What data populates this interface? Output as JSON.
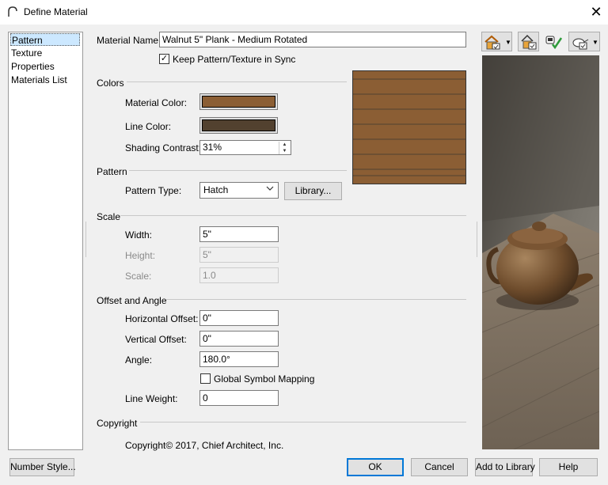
{
  "window": {
    "title": "Define Material",
    "close_glyph": "✕"
  },
  "nav": {
    "items": [
      "Pattern",
      "Texture",
      "Properties",
      "Materials List"
    ],
    "selected": "Pattern"
  },
  "material": {
    "name_label": "Material Name:",
    "name_value": "Walnut 5\" Plank - Medium Rotated",
    "keep_sync_label": "Keep Pattern/Texture in Sync",
    "keep_sync_checked": true
  },
  "colors": {
    "heading": "Colors",
    "material_color_label": "Material Color:",
    "material_color": "#8b5e34",
    "line_color_label": "Line Color:",
    "line_color": "#52412f",
    "shading_contrast_label": "Shading Contrast:",
    "shading_contrast_value": "31%"
  },
  "pattern": {
    "heading": "Pattern",
    "type_label": "Pattern Type:",
    "type_value": "Hatch",
    "library_button": "Library..."
  },
  "scale": {
    "heading": "Scale",
    "width_label": "Width:",
    "width_value": "5\"",
    "height_label": "Height:",
    "height_value": "5\"",
    "scale_label": "Scale:",
    "scale_value": "1.0"
  },
  "offset": {
    "heading": "Offset and Angle",
    "horizontal_label": "Horizontal Offset:",
    "horizontal_value": "0\"",
    "vertical_label": "Vertical Offset:",
    "vertical_value": "0\"",
    "angle_label": "Angle:",
    "angle_value": "180.0°",
    "global_mapping_label": "Global Symbol Mapping",
    "global_mapping_checked": false,
    "line_weight_label": "Line Weight:",
    "line_weight_value": "0"
  },
  "copyright": {
    "heading": "Copyright",
    "text": "Copyright© 2017, Chief Architect, Inc."
  },
  "footer": {
    "number_style": "Number Style...",
    "ok": "OK",
    "cancel": "Cancel",
    "add_to_library": "Add to Library",
    "help": "Help"
  },
  "toolbar_icons": [
    "house-view-icon",
    "material-view-icon",
    "plant-check-icon",
    "teapot-view-icon"
  ],
  "colors_theme": {
    "accent": "#0078d7",
    "selection": "#cce8ff"
  }
}
